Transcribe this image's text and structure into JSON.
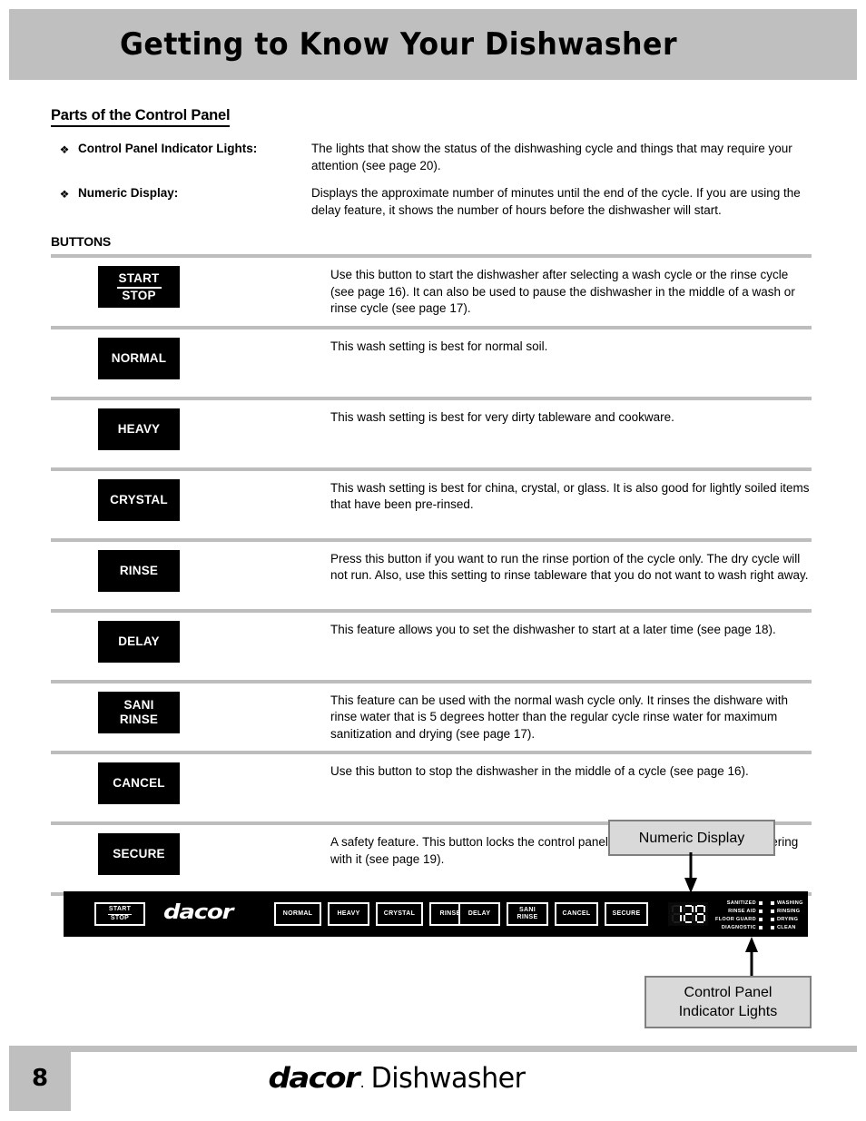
{
  "header": {
    "title": "Getting to Know Your Dishwasher"
  },
  "section": {
    "title": "Parts of the Control Panel",
    "buttons_label": "BUTTONS"
  },
  "definitions": [
    {
      "bullet": "diamond-bullet-icon",
      "term": "Control Panel Indicator Lights:",
      "description": "The lights that show the status of the dishwashing cycle and things that may require your attention (see page 20)."
    },
    {
      "bullet": "diamond-bullet-icon",
      "term": "Numeric Display:",
      "description": "Displays the approximate number of minutes until the end of the cycle. If you are using the delay feature, it shows the number of hours before the dishwasher will start."
    }
  ],
  "button_rows": [
    {
      "label_line1": "START",
      "label_line2": "STOP",
      "description": "Use this button to start the dishwasher after selecting a wash cycle or the rinse cycle (see page 16). It can also be used to pause the dishwasher in the middle of a wash or rinse cycle (see page 17)."
    },
    {
      "label_line1": "NORMAL",
      "label_line2": "",
      "description": "This wash setting is best for normal soil."
    },
    {
      "label_line1": "HEAVY",
      "label_line2": "",
      "description": "This wash setting is best for very dirty tableware and cookware."
    },
    {
      "label_line1": "CRYSTAL",
      "label_line2": "",
      "description": "This wash setting is best for china, crystal, or glass. It is also good for lightly soiled items that have been pre-rinsed."
    },
    {
      "label_line1": "RINSE",
      "label_line2": "",
      "description": "Press this button if you want to run the rinse portion of the cycle only. The dry cycle will not run. Also, use this setting to rinse tableware that you do not want to wash right away."
    },
    {
      "label_line1": "DELAY",
      "label_line2": "",
      "description": "This feature allows you to set the dishwasher to start at a later time (see page 18)."
    },
    {
      "label_line1": "SANI",
      "label_line2": "RINSE",
      "description": "This feature can be used with the normal wash cycle only. It rinses the dishware with rinse water that is 5 degrees hotter than the regular cycle rinse water for maximum sanitization and drying (see page 17)."
    },
    {
      "label_line1": "CANCEL",
      "label_line2": "",
      "description": "Use this button to stop the dishwasher in the middle of a cycle (see page 16)."
    },
    {
      "label_line1": "SECURE",
      "label_line2": "",
      "description": "A safety feature. This button locks the control panel to prevent children from tampering with it (see page 19)."
    }
  ],
  "callouts": {
    "numeric_display": "Numeric Display",
    "indicator_lights_line1": "Control Panel",
    "indicator_lights_line2": "Indicator Lights"
  },
  "control_panel": {
    "brand": "dacor",
    "start_stop_line1": "START",
    "start_stop_line2": "STOP",
    "cycle_keys": [
      "NORMAL",
      "HEAVY",
      "CRYSTAL",
      "RINSE"
    ],
    "option_keys": [
      {
        "line1": "DELAY",
        "line2": ""
      },
      {
        "line1": "SANI",
        "line2": "RINSE"
      },
      {
        "line1": "CANCEL",
        "line2": ""
      },
      {
        "line1": "SECURE",
        "line2": ""
      }
    ],
    "display_value": "128",
    "indicators_left": [
      "SANITIZED",
      "RINSE AID",
      "FLOOR GUARD",
      "DIAGNOSTIC"
    ],
    "indicators_right": [
      "WASHING",
      "RINSING",
      "DRYING",
      "CLEAN"
    ]
  },
  "footer": {
    "page_number": "8",
    "brand": "dacor",
    "brand_mark": ".",
    "product": "Dishwasher"
  },
  "colors": {
    "header_gray": "#bfbfbf",
    "rule_gray": "#bdbdbd",
    "callout_fill": "#d9d9d9",
    "callout_border": "#808080",
    "panel_black": "#000000"
  }
}
